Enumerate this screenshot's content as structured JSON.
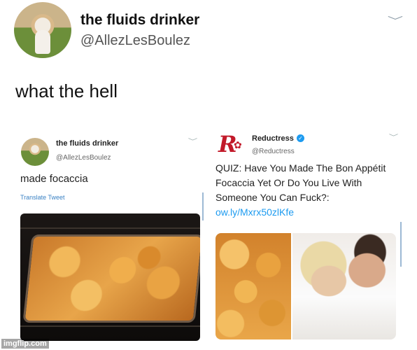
{
  "tweet": {
    "name": "the fluids drinker",
    "handle": "@AllezLesBoulez",
    "text": "what the hell"
  },
  "quoted_left": {
    "name": "the fluids drinker",
    "handle": "@AllezLesBoulez",
    "text": "made focaccia",
    "translate_label": "Translate Tweet"
  },
  "quoted_right": {
    "logo_letter": "R",
    "name": "Reductress",
    "handle": "@Reductress",
    "text": "QUIZ: Have You Made The Bon Appétit Focaccia Yet Or Do You Live With Someone You Can Fuck?:",
    "link": "ow.ly/Mxrx50zlKfe"
  },
  "watermark": "imgflip.com",
  "icons": {
    "chevron": "chevron-down-icon",
    "verified": "verified-badge-icon"
  },
  "colors": {
    "link": "#1d9bf0",
    "brand_red": "#c21a2a"
  }
}
